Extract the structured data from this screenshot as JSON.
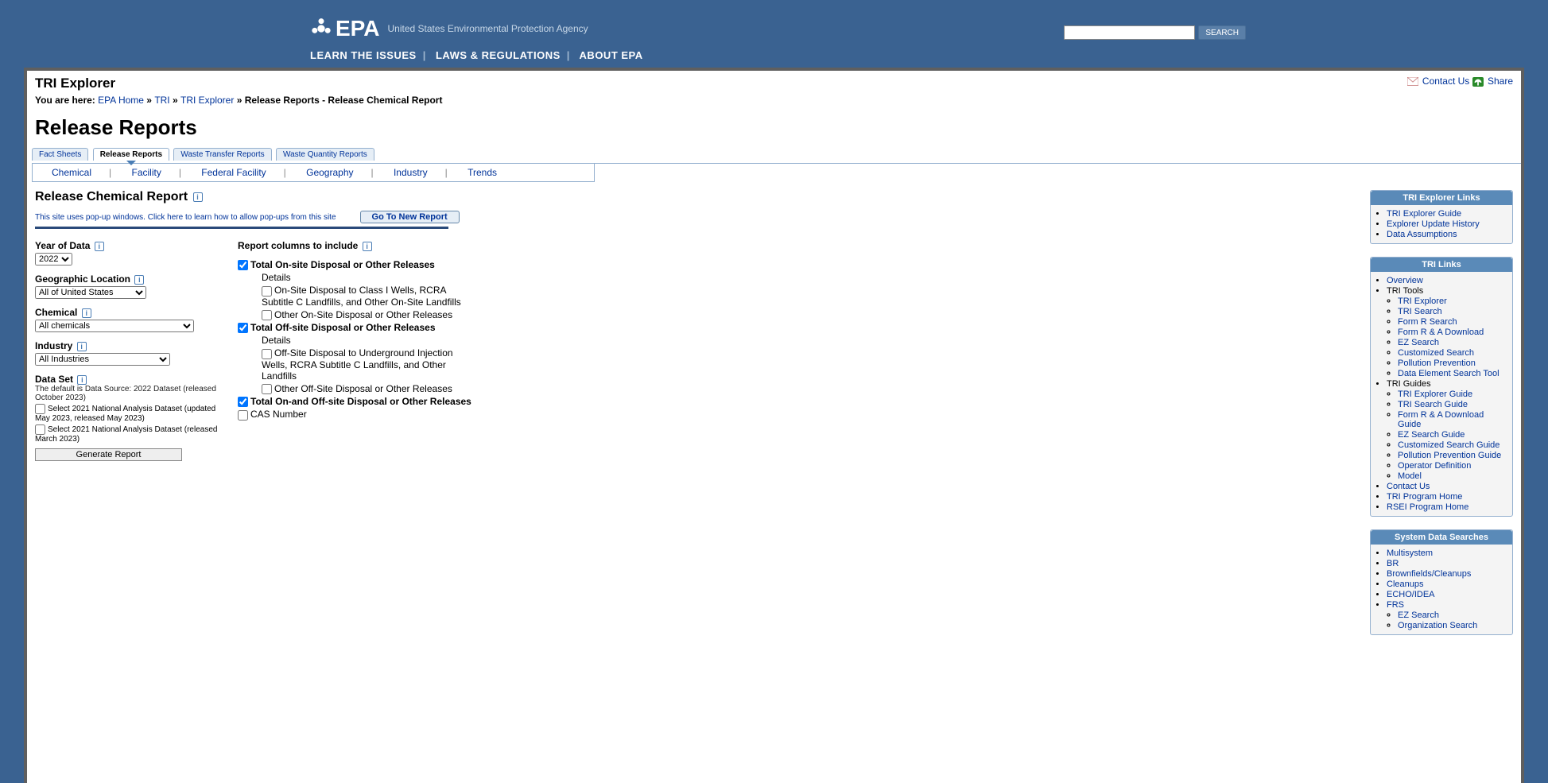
{
  "header": {
    "agency": "United States Environmental Protection Agency",
    "logo_text": "EPA",
    "links": [
      "LEARN THE ISSUES",
      "LAWS & REGULATIONS",
      "ABOUT EPA"
    ],
    "search_btn": "SEARCH"
  },
  "actions": {
    "contact": "Contact Us",
    "share": "Share"
  },
  "page": {
    "app": "TRI Explorer",
    "bc_label": "You are here:",
    "bc": [
      "EPA Home",
      "TRI",
      "TRI Explorer"
    ],
    "bc_tail": "Release Reports - Release Chemical Report",
    "h1": "Release Reports"
  },
  "tabs": [
    "Fact Sheets",
    "Release Reports",
    "Waste Transfer Reports",
    "Waste Quantity Reports"
  ],
  "subtabs": [
    "Chemical",
    "Facility",
    "Federal Facility",
    "Geography",
    "Industry",
    "Trends"
  ],
  "report": {
    "h2": "Release Chemical Report",
    "popup_note": "This site uses pop-up windows. Click here to learn how to allow pop-ups from this site",
    "new_report_btn": "Go To New Report"
  },
  "form": {
    "year_lbl": "Year of Data",
    "year_val": "2022",
    "geo_lbl": "Geographic Location",
    "geo_val": "All of United States",
    "chem_lbl": "Chemical",
    "chem_val": "All chemicals",
    "ind_lbl": "Industry",
    "ind_val": "All Industries",
    "ds_lbl": "Data Set",
    "ds_note": "The default is Data Source: 2022 Dataset (released October 2023)",
    "ds_opt1": "Select 2021 National Analysis Dataset (updated May 2023, released May 2023)",
    "ds_opt2": "Select 2021 National Analysis Dataset (released March 2023)",
    "gen_btn": "Generate Report"
  },
  "cols": {
    "heading": "Report columns to include",
    "c1": "Total On-site Disposal or Other Releases",
    "details": "Details",
    "c1a": "On-Site Disposal to Class I Wells, RCRA Subtitle C Landfills, and Other On-Site Landfills",
    "c1b": "Other On-Site Disposal or Other Releases",
    "c2": "Total Off-site Disposal or Other Releases",
    "c2a": "Off-Site Disposal to Underground Injection Wells, RCRA Subtitle C Landfills, and Other Landfills",
    "c2b": "Other Off-Site Disposal or Other Releases",
    "c3": "Total On-and Off-site Disposal or Other Releases",
    "c4": "CAS Number"
  },
  "side": {
    "p1_h": "TRI Explorer Links",
    "p1": [
      "TRI Explorer Guide",
      "Explorer Update History",
      "Data Assumptions"
    ],
    "p2_h": "TRI Links",
    "p2_overview": "Overview",
    "p2_tools_h": "TRI Tools",
    "p2_tools": [
      "TRI Explorer",
      "TRI Search",
      "Form R Search",
      "Form R & A Download",
      "EZ Search",
      "Customized Search",
      "Pollution Prevention",
      "Data Element Search Tool"
    ],
    "p2_guides_h": "TRI Guides",
    "p2_guides": [
      "TRI Explorer Guide",
      "TRI Search Guide",
      "Form R & A Download Guide",
      "EZ Search Guide",
      "Customized Search Guide",
      "Pollution Prevention Guide",
      "Operator Definition",
      "Model"
    ],
    "p2_rest": [
      "Contact Us",
      "TRI Program Home",
      "RSEI Program Home"
    ],
    "p3_h": "System Data Searches",
    "p3": [
      "Multisystem",
      "BR",
      "Brownfields/Cleanups",
      "Cleanups",
      "ECHO/IDEA",
      "FRS"
    ],
    "p3_sub": [
      "EZ Search",
      "Organization Search"
    ]
  }
}
